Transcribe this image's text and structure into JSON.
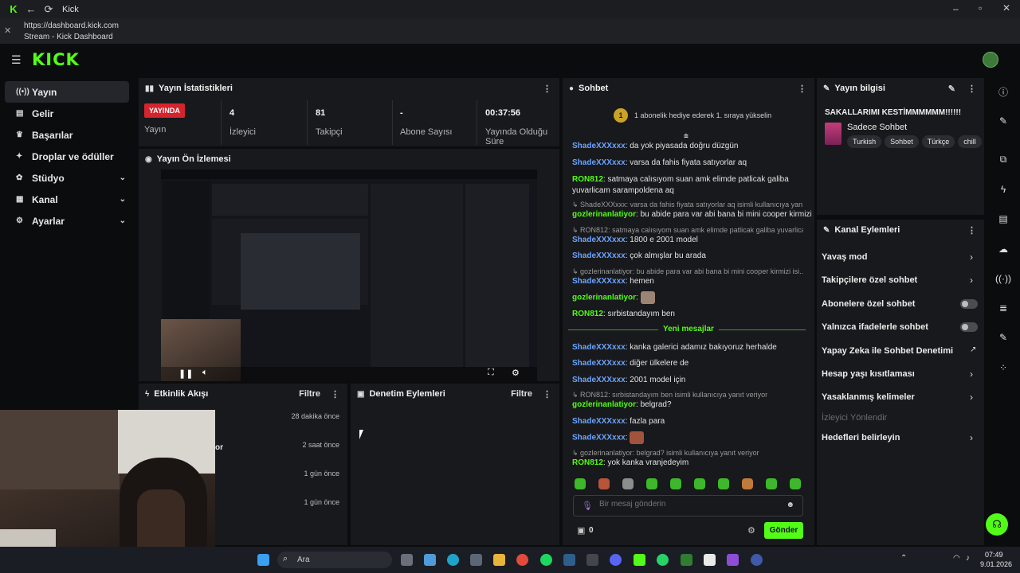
{
  "browser": {
    "tab_title": "Kick",
    "url": "https://dashboard.kick.com",
    "page_title": "Stream - Kick Dashboard"
  },
  "app": {
    "logo": "KICK"
  },
  "sidebar": {
    "items": [
      {
        "label": "Yayın",
        "icon": "broadcast-icon",
        "active": true
      },
      {
        "label": "Gelir",
        "icon": "revenue-icon"
      },
      {
        "label": "Başarılar",
        "icon": "trophy-icon"
      },
      {
        "label": "Droplar ve ödüller",
        "icon": "gift-icon"
      },
      {
        "label": "Stüdyo",
        "icon": "studio-icon",
        "expandable": true
      },
      {
        "label": "Kanal",
        "icon": "channel-icon",
        "expandable": true
      },
      {
        "label": "Ayarlar",
        "icon": "gear-icon",
        "expandable": true
      }
    ]
  },
  "stats": {
    "title": "Yayın İstatistikleri",
    "live_badge": "YAYINDA",
    "live_label": "Yayın",
    "viewers_value": "4",
    "viewers_label": "İzleyici",
    "followers_value": "81",
    "followers_label": "Takipçi",
    "subs_value": "-",
    "subs_label": "Abone Sayısı",
    "uptime_value": "00:37:56",
    "uptime_label": "Yayında Olduğu Süre"
  },
  "preview": {
    "title": "Yayın Ön İzlemesi"
  },
  "activity": {
    "title": "Etkinlik Akışı",
    "filter": "Filtre",
    "items": [
      {
        "text": "",
        "time": "28 dakika önce"
      },
      {
        "text": "or",
        "time": "2 saat önce"
      },
      {
        "text": "",
        "time": "1 gün önce"
      },
      {
        "text": "",
        "time": "1 gün önce"
      }
    ]
  },
  "moderation": {
    "title": "Denetim Eylemleri",
    "filter": "Filtre"
  },
  "chat": {
    "title": "Sohbet",
    "banner_rank": "1",
    "banner": "1 abonelik hediye ederek 1. sıraya yükselin",
    "new_messages": "Yeni mesajlar",
    "input_placeholder": "Bir mesaj gönderin",
    "points": "0",
    "send": "Gönder",
    "messages": [
      {
        "user": "ShadeXXXxxx",
        "text": "da yok piyasada doğru düzgün"
      },
      {
        "user": "ShadeXXXxxx",
        "text": "varsa da fahis fiyata satıyorlar aq"
      },
      {
        "user": "RON812",
        "text": "satmaya calısıyom suan amk elimde patlicak galiba"
      },
      {
        "user": "",
        "text": "yuvarlicam sarampoldena aq"
      },
      {
        "reply": "ShadeXXXxxx: varsa da fahis fiyata satıyorlar aq isimli kullanıcıya yanı..."
      },
      {
        "user": "gozlerinanlatiyor",
        "text": "bu abide para var abi bana bi mini cooper kirmizi"
      },
      {
        "reply": "RON812: satmaya calısıyom suan amk elimde patlicak galiba yuvarlica..."
      },
      {
        "user": "ShadeXXXxxx",
        "text": "1800 e 2001 model"
      },
      {
        "user": "ShadeXXXxxx",
        "text": "çok almışlar bu arada"
      },
      {
        "reply": "gozlerinanlatiyor: bu abide para var abi bana bi mini cooper kirmizi isi..."
      },
      {
        "user": "ShadeXXXxxx",
        "text": "hemen"
      },
      {
        "user": "gozlerinanlatiyor",
        "text": ""
      },
      {
        "user": "RON812",
        "text": "sırbistandayım ben"
      },
      {
        "user": "ShadeXXXxxx",
        "text": "kanka galerici adamız bakıyoruz herhalde"
      },
      {
        "user": "ShadeXXXxxx",
        "text": "diğer ülkelere de"
      },
      {
        "user": "ShadeXXXxxx",
        "text": "2001 model için"
      },
      {
        "reply": "RON812: sırbistandayım ben isimli kullanıcıya yanıt veriyor"
      },
      {
        "user": "gozlerinanlatiyor",
        "text": "belgrad?"
      },
      {
        "user": "ShadeXXXxxx",
        "text": "fazla para"
      },
      {
        "user": "ShadeXXXxxx",
        "text": ""
      },
      {
        "reply": "gozlerinanlatiyor: belgrad? isimli kullanıcıya yanıt veriyor"
      },
      {
        "user": "RON812",
        "text": "yok kanka vranjedeyim"
      }
    ]
  },
  "stream_info": {
    "title": "Yayın bilgisi",
    "stream_title": "SAKALLARIMI KESTİMMMMMM!!!!!!",
    "category": "Sadece Sohbet",
    "tags": [
      "Turkish",
      "Sohbet",
      "Türkçe",
      "chill"
    ]
  },
  "channel_actions": {
    "title": "Kanal Eylemleri",
    "items": [
      {
        "label": "Yavaş mod",
        "control": "chevron"
      },
      {
        "label": "Takipçilere özel sohbet",
        "control": "chevron"
      },
      {
        "label": "Abonelere özel sohbet",
        "control": "toggle"
      },
      {
        "label": "Yalnızca ifadelerle sohbet",
        "control": "toggle"
      },
      {
        "label": "Yapay Zeka ile Sohbet Denetimi",
        "control": "external"
      },
      {
        "label": "Hesap yaşı kısıtlaması",
        "control": "chevron"
      },
      {
        "label": "Yasaklanmış kelimeler",
        "control": "chevron"
      },
      {
        "label": "İzleyici Yönlendir",
        "control": "none",
        "disabled": true
      },
      {
        "label": "Hedefleri belirleyin",
        "control": "chevron"
      }
    ]
  },
  "taskbar": {
    "search": "Ara",
    "time": "07:49",
    "date": "9.01.2026"
  },
  "colors": {
    "accent": "#53fc18",
    "live": "#d4242e",
    "panel": "#18191c",
    "bg": "#0b0c0e",
    "username_blue": "#6ba4ff"
  }
}
